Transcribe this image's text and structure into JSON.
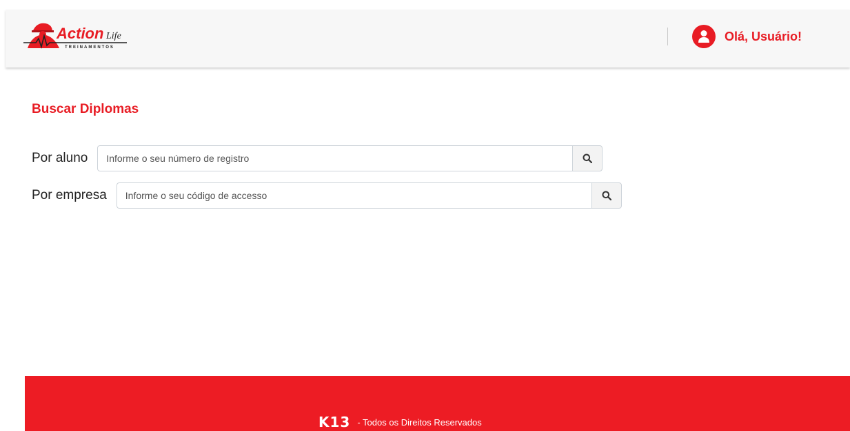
{
  "header": {
    "logo_text": "Action",
    "logo_script": "Life",
    "logo_sub": "TREINAMENTOS",
    "greeting": "Olá, Usuário!"
  },
  "main": {
    "title": "Buscar Diplomas",
    "aluno": {
      "label": "Por aluno",
      "placeholder": "Informe o seu número de registro"
    },
    "empresa": {
      "label": "Por empresa",
      "placeholder": "Informe o seu código de accesso"
    }
  },
  "footer": {
    "brand": "K13",
    "text": "- Todos os Direitos Reservados"
  },
  "colors": {
    "accent": "#e81c24",
    "footer": "#ed1c24"
  },
  "icons": [
    "logo-worker-icon",
    "user-avatar-icon",
    "search-icon"
  ]
}
